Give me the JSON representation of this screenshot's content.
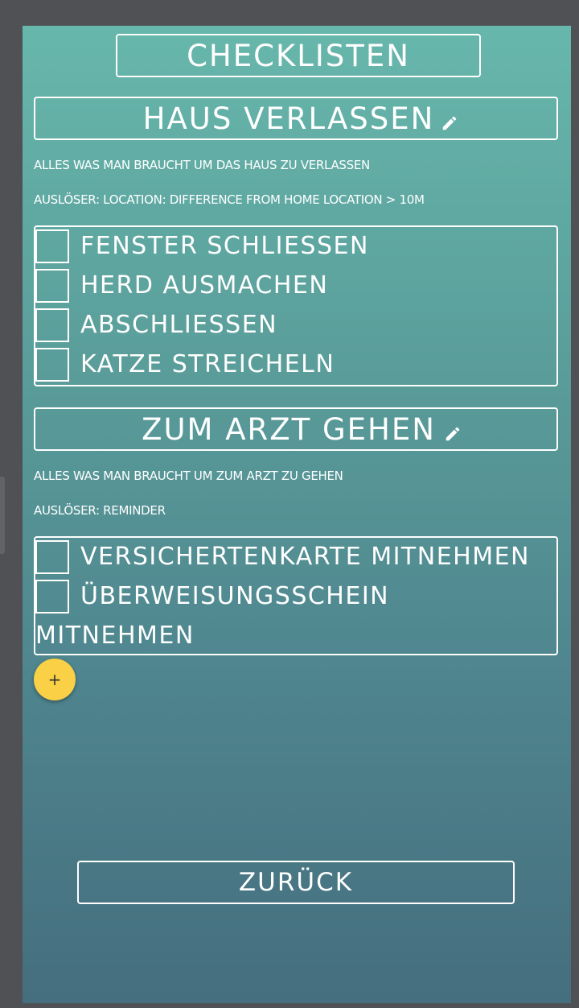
{
  "app": {
    "title": "CHECKLISTEN",
    "back_label": "ZURÜCK",
    "add_label": "+"
  },
  "lists": [
    {
      "name": "HAUS VERLASSEN",
      "description": "ALLES WAS MAN BRAUCHT UM DAS HAUS ZU VERLASSEN",
      "trigger": "AUSLÖSER: LOCATION: DIFFERENCE FROM HOME LOCATION > 10M",
      "items": [
        {
          "label": "FENSTER SCHLIESSEN",
          "checked": false
        },
        {
          "label": "HERD AUSMACHEN",
          "checked": false
        },
        {
          "label": "ABSCHLIESSEN",
          "checked": false
        },
        {
          "label": "KATZE STREICHELN",
          "checked": false
        }
      ]
    },
    {
      "name": "ZUM ARZT GEHEN",
      "description": "ALLES WAS MAN BRAUCHT UM ZUM ARZT ZU GEHEN",
      "trigger": "AUSLÖSER: REMINDER",
      "items": [
        {
          "label": "VERSICHERTENKARTE MITNEHMEN",
          "checked": false
        },
        {
          "label": "ÜBERWEISUNGSSCHEIN MITNEHMEN",
          "checked": false
        }
      ]
    }
  ],
  "icons": {
    "edit": "pencil-icon",
    "add": "plus-icon"
  },
  "colors": {
    "gradient_top": "#67b7ac",
    "gradient_bottom": "#456e7e",
    "fab": "#f9d046",
    "outline": "#ffffff"
  }
}
